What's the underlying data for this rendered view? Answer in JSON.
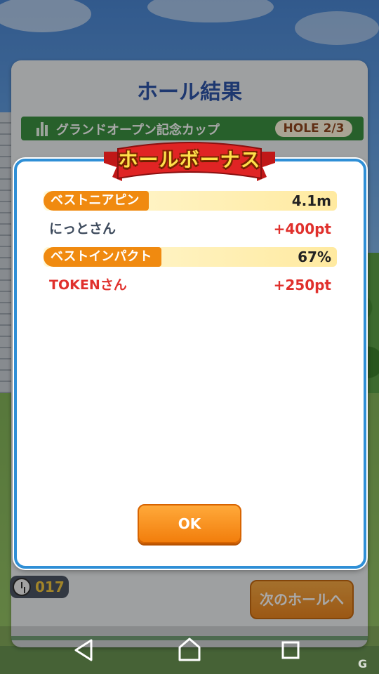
{
  "screen": {
    "title": "ホール結果",
    "tournament": "グランドオープン記念カップ",
    "hole_indicator": "HOLE 2/3",
    "timer_count": "017",
    "next_hole_label": "次のホールへ"
  },
  "bonus_dialog": {
    "banner": "ホールボーナス",
    "rows": [
      {
        "category": "ベストニアピン",
        "value": "4.1m",
        "winner": "にっとさん",
        "winner_color": "#3d4a5c",
        "points": "+400pt"
      },
      {
        "category": "ベストインパクト",
        "value": "67%",
        "winner": "TOKENさん",
        "winner_color": "#e0302c",
        "points": "+250pt"
      }
    ],
    "ok_label": "OK"
  },
  "colors": {
    "accent_orange": "#f08a10",
    "dialog_border": "#2f8fd6",
    "title_blue": "#1f4aa3",
    "points_red": "#e0302c"
  },
  "navbar": {
    "icons": [
      "back-icon",
      "home-icon",
      "recents-icon"
    ]
  },
  "watermark": "G"
}
